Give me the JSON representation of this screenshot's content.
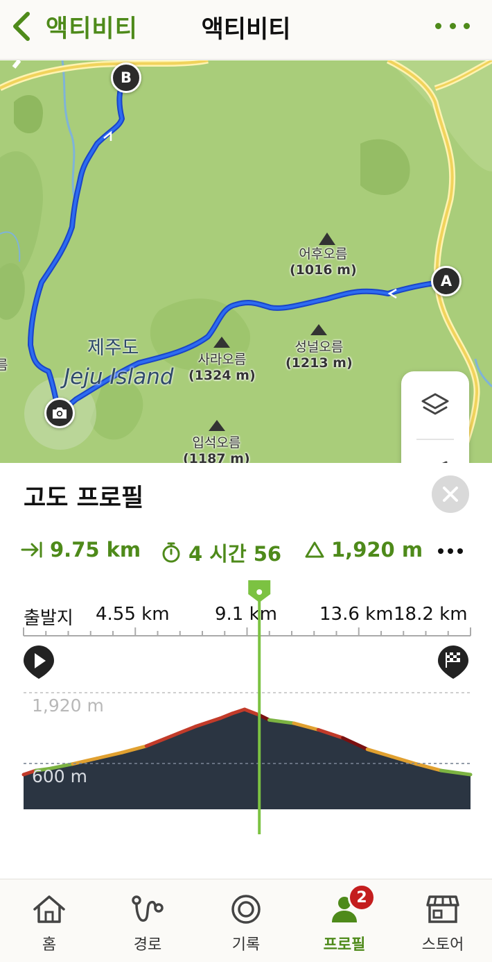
{
  "header": {
    "back_label": "액티비티",
    "title": "액티비티"
  },
  "map": {
    "island_name_ko": "제주도",
    "island_name_en": "Jeju Island",
    "start_marker": "A",
    "end_marker": "B",
    "peaks": [
      {
        "name": "어후오름",
        "elev": "(1016 m)"
      },
      {
        "name": "사라오름",
        "elev": "(1324 m)"
      },
      {
        "name": "성널오름",
        "elev": "(1213 m)"
      },
      {
        "name": "입석오름",
        "elev": "(1187 m)"
      }
    ],
    "partial_label": "름",
    "icons": [
      "layers-icon",
      "navigation-arrow-icon",
      "info-icon",
      "camera-icon"
    ]
  },
  "panel": {
    "title": "고도 프로필",
    "stats": {
      "distance": "9.75 km",
      "duration": "4 시간 56",
      "elevation": "1,920 m"
    },
    "axis_labels": [
      "출발지",
      "4.55 km",
      "9.1 km",
      "13.6 km",
      "18.2 km"
    ],
    "elev_max_label": "1,920 m",
    "elev_min_label": "600 m"
  },
  "chart_data": {
    "type": "area",
    "title": "고도 프로필",
    "xlabel": "",
    "ylabel": "",
    "x_ticks": [
      "출발지",
      "4.55 km",
      "9.1 km",
      "13.6 km",
      "18.2 km"
    ],
    "y_ticks": [
      "600 m",
      "1,920 m"
    ],
    "x": [
      0,
      0.5,
      1,
      2,
      3,
      4,
      5,
      6,
      7,
      8,
      8.5,
      9,
      9.6,
      10,
      11,
      12,
      13,
      14,
      15,
      16,
      17,
      18.2
    ],
    "y": [
      250,
      300,
      320,
      380,
      450,
      520,
      600,
      720,
      840,
      940,
      1000,
      1050,
      980,
      920,
      880,
      800,
      700,
      560,
      470,
      380,
      300,
      250
    ],
    "y_unit": "m",
    "cursor_x_km": 9.6,
    "colors": {
      "profile_fill": "#2b3542",
      "grade_low": "#7cb342",
      "grade_mid": "#e0a030",
      "grade_high": "#c23b2a",
      "grade_steep": "#7a1010",
      "cursor": "#7cc242"
    }
  },
  "bottom_nav": {
    "items": [
      {
        "label": "홈",
        "icon": "home-icon"
      },
      {
        "label": "경로",
        "icon": "route-icon"
      },
      {
        "label": "기록",
        "icon": "record-icon"
      },
      {
        "label": "프로필",
        "icon": "profile-icon"
      },
      {
        "label": "스토어",
        "icon": "store-icon"
      }
    ],
    "active": "프로필",
    "profile_badge": "2"
  }
}
